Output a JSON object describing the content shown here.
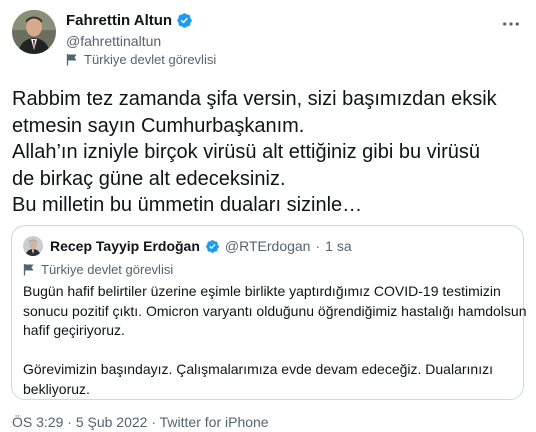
{
  "author": {
    "display_name": "Fahrettin Altun",
    "handle": "@fahrettinaltun",
    "gov_label": "Türkiye devlet görevlisi"
  },
  "more_icon": "more-horizontal-icon",
  "tweet_lines": [
    "Rabbim tez zamanda şifa versin, sizi başımızdan eksik",
    "etmesin sayın Cumhurbaşkanım.",
    "Allah’ın izniyle birçok virüsü alt ettiğiniz gibi bu virüsü",
    "de birkaç güne alt edeceksiniz.",
    "Bu milletin bu ümmetin duaları sizinle…"
  ],
  "quote": {
    "display_name": "Recep Tayyip Erdoğan",
    "handle": "@RTErdogan",
    "separator": "·",
    "time": "1 sa",
    "gov_label": "Türkiye devlet görevlisi",
    "lines": [
      "Bugün hafif belirtiler üzerine eşimle birlikte yaptırdığımız COVID-19 testimizin",
      "sonucu pozitif çıktı. Omicron varyantı olduğunu öğrendiğimiz hastalığı hamdolsun",
      "hafif geçiriyoruz.",
      "",
      "Görevimizin başındayız. Çalışmalarımıza evde devam edeceğiz. Dualarınızı",
      "bekliyoruz."
    ]
  },
  "meta": {
    "time": "ÖS 3:29",
    "dot1": " · ",
    "date": "5 Şub 2022",
    "dot2": " · ",
    "source": "Twitter for iPhone"
  },
  "colors": {
    "text": "#0f1419",
    "secondary": "#536471",
    "verified": "#1d9bf0",
    "border": "#cfd9de"
  }
}
